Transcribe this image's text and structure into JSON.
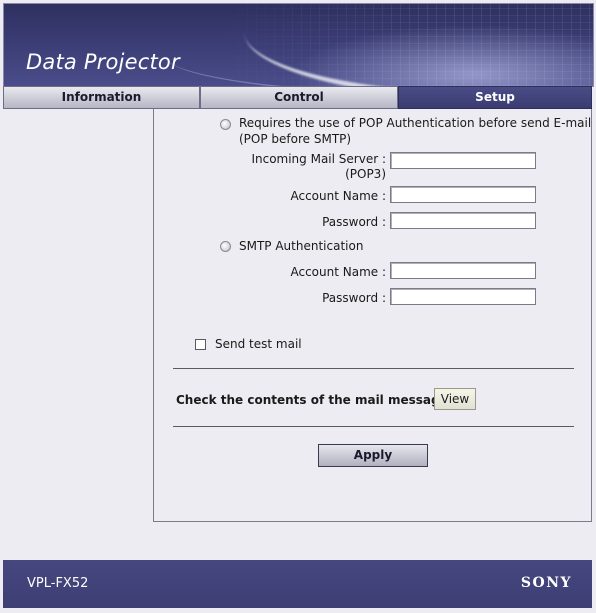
{
  "header": {
    "title": "Data Projector"
  },
  "tabs": [
    {
      "label": "Information",
      "active": false
    },
    {
      "label": "Control",
      "active": false
    },
    {
      "label": "Setup",
      "active": true
    }
  ],
  "form": {
    "pop_option_line1": "Requires the use of POP Authentication before send E-mail",
    "pop_option_line2": "(POP before SMTP)",
    "incoming_server_label": "Incoming Mail Server :",
    "incoming_server_label2": "(POP3)",
    "incoming_server_value": "",
    "pop_account_label": "Account Name :",
    "pop_account_value": "",
    "pop_password_label": "Password :",
    "pop_password_value": "",
    "smtp_auth_label": "SMTP Authentication",
    "smtp_account_label": "Account Name :",
    "smtp_account_value": "",
    "smtp_password_label": "Password :",
    "smtp_password_value": "",
    "send_test_mail_label": "Send test mail",
    "check_contents_label": "Check the contents of the mail message",
    "view_button": "View",
    "apply_button": "Apply"
  },
  "footer": {
    "model": "VPL-FX52",
    "brand": "SONY"
  },
  "colors": {
    "banner": "#3a3c74",
    "active_tab": "#3f4178",
    "footer": "#414379",
    "background": "#ececf2"
  }
}
